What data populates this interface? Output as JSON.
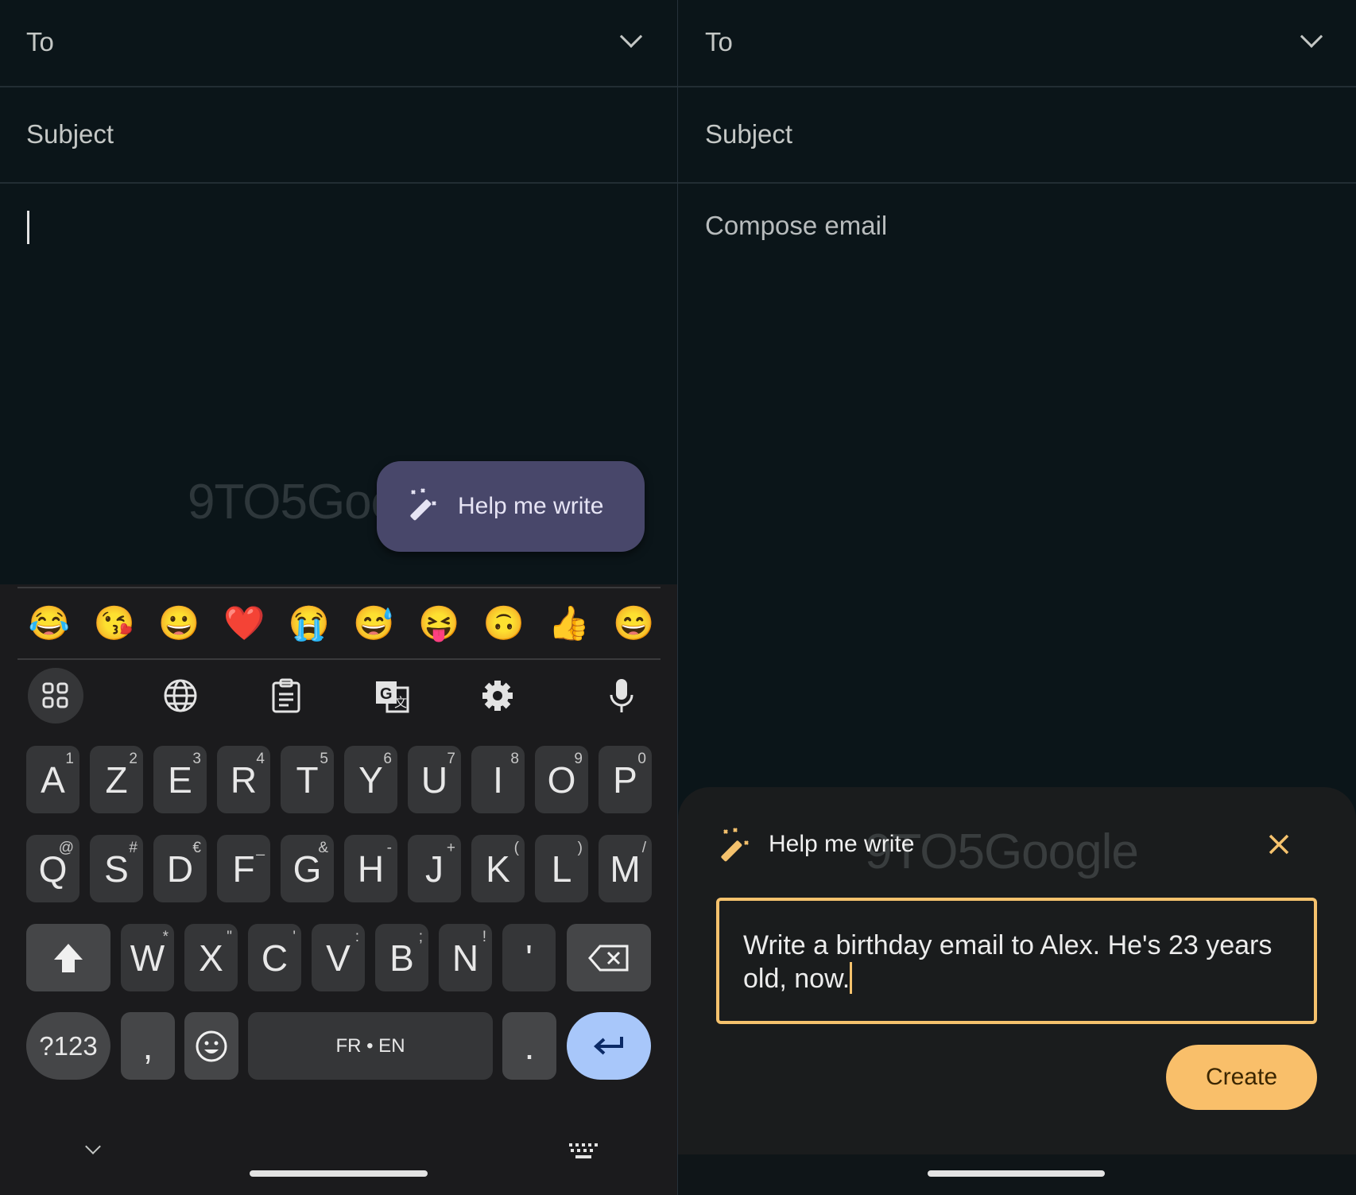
{
  "left": {
    "to_label": "To",
    "subject_placeholder": "Subject",
    "watermark": "9TO5Google",
    "help_button_label": "Help me write",
    "emoji_suggestions": [
      "😂",
      "😘",
      "😀",
      "❤️",
      "😭",
      "😅",
      "😝",
      "🙃",
      "👍",
      "😄"
    ],
    "toolbar_icons": [
      "apps-grid-icon",
      "globe-icon",
      "clipboard-icon",
      "translate-icon",
      "settings-gear-icon",
      "microphone-icon"
    ],
    "keyboard": {
      "row1": [
        [
          "A",
          "1"
        ],
        [
          "Z",
          "2"
        ],
        [
          "E",
          "3"
        ],
        [
          "R",
          "4"
        ],
        [
          "T",
          "5"
        ],
        [
          "Y",
          "6"
        ],
        [
          "U",
          "7"
        ],
        [
          "I",
          "8"
        ],
        [
          "O",
          "9"
        ],
        [
          "P",
          "0"
        ]
      ],
      "row2": [
        [
          "Q",
          "@"
        ],
        [
          "S",
          "#"
        ],
        [
          "D",
          "€"
        ],
        [
          "F",
          "_"
        ],
        [
          "G",
          "&"
        ],
        [
          "H",
          "-"
        ],
        [
          "J",
          "+"
        ],
        [
          "K",
          "("
        ],
        [
          "L",
          ")"
        ],
        [
          "M",
          "/"
        ]
      ],
      "row3": [
        [
          "W",
          "*"
        ],
        [
          "X",
          "\""
        ],
        [
          "C",
          "'"
        ],
        [
          "V",
          ":"
        ],
        [
          "B",
          ";"
        ],
        [
          "N",
          "!"
        ],
        [
          "'",
          ""
        ]
      ],
      "symbols_label": "?123",
      "comma_label": ",",
      "space_label": "FR • EN",
      "period_label": ".",
      "enter_color": "#a8c7fa"
    }
  },
  "right": {
    "to_label": "To",
    "subject_placeholder": "Subject",
    "body_placeholder": "Compose email",
    "sheet": {
      "title": "Help me write",
      "watermark": "9TO5Google",
      "prompt_text": "Write a birthday email to Alex. He's 23 years old, now.",
      "create_label": "Create",
      "accent_color": "#f9bf6a"
    }
  }
}
